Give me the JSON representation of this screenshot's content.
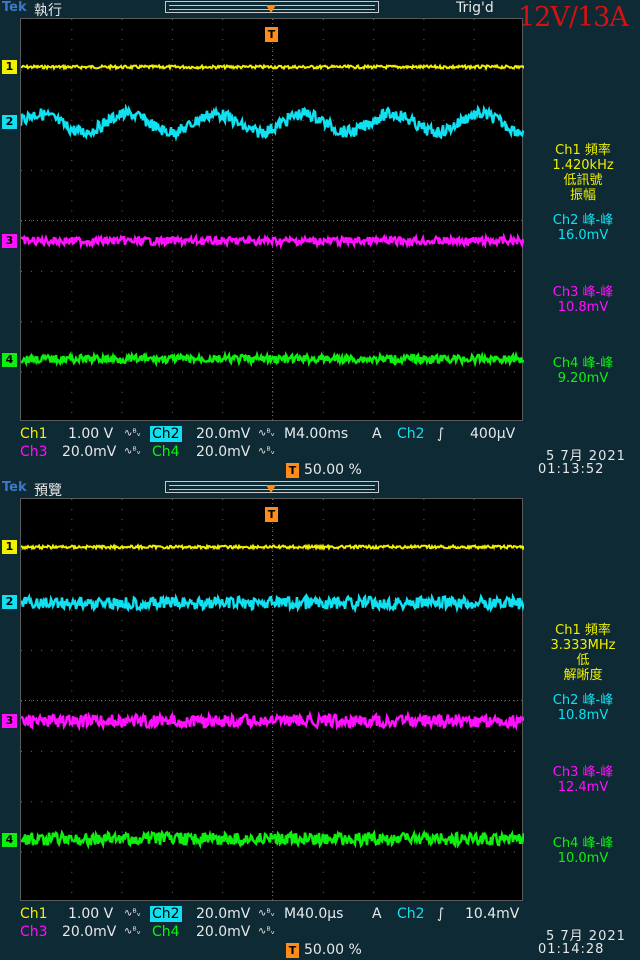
{
  "overlay_label": "12V/13A",
  "colors": {
    "ch1": "#f0f000",
    "ch2": "#10e0f0",
    "ch3": "#ff10ff",
    "ch4": "#10f010",
    "trigger": "#ff8c1a"
  },
  "panels": [
    {
      "brand": "Tek",
      "mode": "執行",
      "trigger_status": "Trig'd",
      "trigger_marker": "T",
      "ch_markers": [
        "1",
        "2",
        "3",
        "4"
      ],
      "ch2_waveform": "sine",
      "readouts": [
        {
          "title": "Ch1 頻率",
          "value": "1.420kHz",
          "note": "低訊號",
          "note2": "振幅"
        },
        {
          "title": "Ch2 峰-峰",
          "value": "16.0mV"
        },
        {
          "title": "Ch3 峰-峰",
          "value": "10.8mV"
        },
        {
          "title": "Ch4 峰-峰",
          "value": "9.20mV"
        }
      ],
      "settings": {
        "ch1_label": "Ch1",
        "ch1_scale": "1.00 V",
        "ch1_icon": "∿ᴮᵥ",
        "ch2_label": "Ch2",
        "ch2_scale": "20.0mV",
        "ch2_icon": "∿ᴮᵥ",
        "ch3_label": "Ch3",
        "ch3_scale": "20.0mV",
        "ch3_icon": "∿ᴮᵥ",
        "ch4_label": "Ch4",
        "ch4_scale": "20.0mV",
        "ch4_icon": "∿ᴮᵥ",
        "timebase": "M4.00ms",
        "trig_mode": "A",
        "trig_source": "Ch2",
        "trig_slope": "∫",
        "trig_level": "400µV",
        "trig_pos": "50.00 %"
      },
      "date": "5 7月  2021",
      "time": "01:13:52"
    },
    {
      "brand": "Tek",
      "mode": "預覽",
      "trigger_status": "",
      "trigger_marker": "T",
      "ch_markers": [
        "1",
        "2",
        "3",
        "4"
      ],
      "ch2_waveform": "noise",
      "readouts": [
        {
          "title": "Ch1 頻率",
          "value": "3.333MHz",
          "note": "低",
          "note2": "解晰度"
        },
        {
          "title": "Ch2 峰-峰",
          "value": "10.8mV"
        },
        {
          "title": "Ch3 峰-峰",
          "value": "12.4mV"
        },
        {
          "title": "Ch4 峰-峰",
          "value": "10.0mV"
        }
      ],
      "settings": {
        "ch1_label": "Ch1",
        "ch1_scale": "1.00 V",
        "ch1_icon": "∿ᴮᵥ",
        "ch2_label": "Ch2",
        "ch2_scale": "20.0mV",
        "ch2_icon": "∿ᴮᵥ",
        "ch3_label": "Ch3",
        "ch3_scale": "20.0mV",
        "ch3_icon": "∿ᴮᵥ",
        "ch4_label": "Ch4",
        "ch4_scale": "20.0mV",
        "ch4_icon": "∿ᴮᵥ",
        "timebase": "M40.0µs",
        "trig_mode": "A",
        "trig_source": "Ch2",
        "trig_slope": "∫",
        "trig_level": "10.4mV",
        "trig_pos": "50.00 %"
      },
      "date": "5 7月  2021",
      "time": "01:14:28"
    }
  ]
}
